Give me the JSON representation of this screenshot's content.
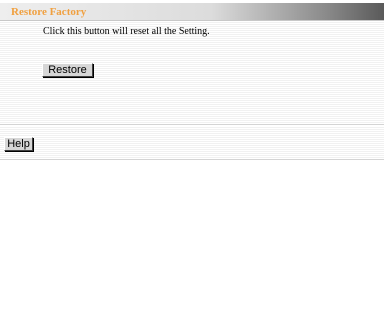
{
  "header": {
    "title": "Restore Factory"
  },
  "main": {
    "description": "Click this button will reset all the Setting.",
    "restore_label": "Restore"
  },
  "footer": {
    "help_label": "Help"
  },
  "colors": {
    "title_accent": "#f0a040",
    "button_face": "#d6d6d6"
  }
}
